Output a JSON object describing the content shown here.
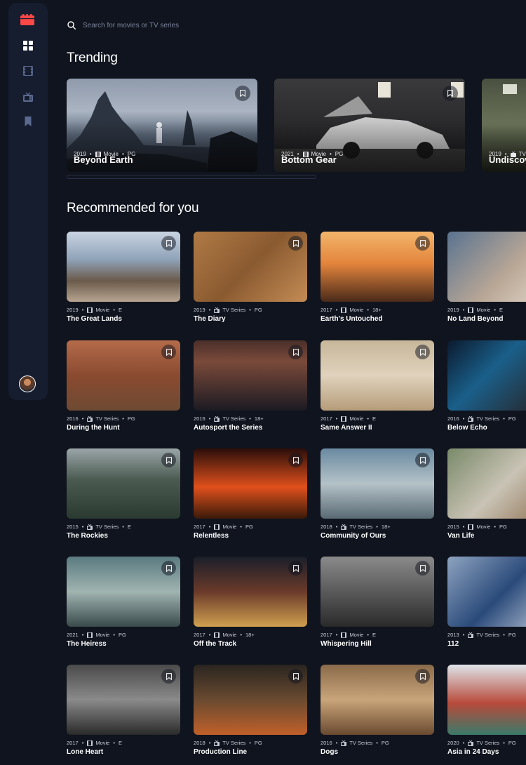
{
  "search": {
    "placeholder": "Search for movies or TV series"
  },
  "colors": {
    "background": "#10141e",
    "sidebar": "#161d2f",
    "accent": "#fc4747",
    "muted": "#5a698f"
  },
  "nav": {
    "items": [
      {
        "icon": "home-grid-icon",
        "active": true
      },
      {
        "icon": "film-strip-icon",
        "active": false
      },
      {
        "icon": "tv-icon",
        "active": false
      },
      {
        "icon": "bookmark-icon",
        "active": false
      }
    ]
  },
  "trending": {
    "title": "Trending",
    "items": [
      {
        "year": "2019",
        "category": "Movie",
        "rating": "PG",
        "title": "Beyond Earth"
      },
      {
        "year": "2021",
        "category": "Movie",
        "rating": "PG",
        "title": "Bottom Gear"
      },
      {
        "year": "2019",
        "category": "TV Series",
        "rating": "",
        "title": "Undiscovered Cities"
      }
    ]
  },
  "recommended": {
    "title": "Recommended for you",
    "items": [
      {
        "year": "2019",
        "category": "Movie",
        "rating": "E",
        "title": "The Great Lands"
      },
      {
        "year": "2019",
        "category": "TV Series",
        "rating": "PG",
        "title": "The Diary"
      },
      {
        "year": "2017",
        "category": "Movie",
        "rating": "18+",
        "title": "Earth's Untouched"
      },
      {
        "year": "2019",
        "category": "Movie",
        "rating": "E",
        "title": "No Land Beyond"
      },
      {
        "year": "2016",
        "category": "TV Series",
        "rating": "PG",
        "title": "During the Hunt"
      },
      {
        "year": "2016",
        "category": "TV Series",
        "rating": "18+",
        "title": "Autosport the Series"
      },
      {
        "year": "2017",
        "category": "Movie",
        "rating": "E",
        "title": "Same Answer II"
      },
      {
        "year": "2016",
        "category": "TV Series",
        "rating": "PG",
        "title": "Below Echo"
      },
      {
        "year": "2015",
        "category": "TV Series",
        "rating": "E",
        "title": "The Rockies"
      },
      {
        "year": "2017",
        "category": "Movie",
        "rating": "PG",
        "title": "Relentless"
      },
      {
        "year": "2018",
        "category": "TV Series",
        "rating": "18+",
        "title": "Community of Ours"
      },
      {
        "year": "2015",
        "category": "Movie",
        "rating": "PG",
        "title": "Van Life"
      },
      {
        "year": "2021",
        "category": "Movie",
        "rating": "PG",
        "title": "The Heiress"
      },
      {
        "year": "2017",
        "category": "Movie",
        "rating": "18+",
        "title": "Off the Track"
      },
      {
        "year": "2017",
        "category": "Movie",
        "rating": "E",
        "title": "Whispering Hill"
      },
      {
        "year": "2013",
        "category": "TV Series",
        "rating": "PG",
        "title": "112"
      },
      {
        "year": "2017",
        "category": "Movie",
        "rating": "E",
        "title": "Lone Heart"
      },
      {
        "year": "2018",
        "category": "TV Series",
        "rating": "PG",
        "title": "Production Line"
      },
      {
        "year": "2016",
        "category": "TV Series",
        "rating": "PG",
        "title": "Dogs"
      },
      {
        "year": "2020",
        "category": "TV Series",
        "rating": "PG",
        "title": "Asia in 24 Days"
      }
    ]
  }
}
